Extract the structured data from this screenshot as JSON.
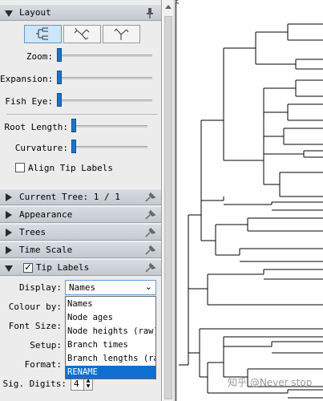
{
  "panel": {
    "layout_header": "Layout",
    "tree_types": [
      "rectangle-tree-icon",
      "radial-tree-icon",
      "polar-tree-icon"
    ],
    "sliders": {
      "zoom": {
        "label": "Zoom:",
        "value": 0
      },
      "expansion": {
        "label": "Expansion:",
        "value": 0
      },
      "fisheye": {
        "label": "Fish Eye:",
        "value": 0
      },
      "root_length": {
        "label": "Root Length:",
        "value": 0
      },
      "curvature": {
        "label": "Curvature:",
        "value": 0
      }
    },
    "align_tip_labels": {
      "label": "Align Tip Labels",
      "checked": false
    },
    "sections": {
      "current_tree": "Current Tree: 1 / 1",
      "appearance": "Appearance",
      "trees": "Trees",
      "time_scale": "Time Scale",
      "tip_labels": "Tip Labels"
    },
    "tip_labels_checked": true,
    "fields": {
      "display": "Display:",
      "colour_by": "Colour by:",
      "font_size": "Font Size:",
      "setup": "Setup:",
      "format": "Format:",
      "sig_digits": "Sig. Digits:"
    },
    "display_value": "Names",
    "display_options": [
      "Names",
      "Node ages",
      "Node heights (raw)",
      "Branch times",
      "Branch lengths (raw",
      "RENAME"
    ],
    "display_selected_option": "RENAME",
    "sig_digits_value": "4"
  },
  "watermark": "知乎 @Never stop"
}
